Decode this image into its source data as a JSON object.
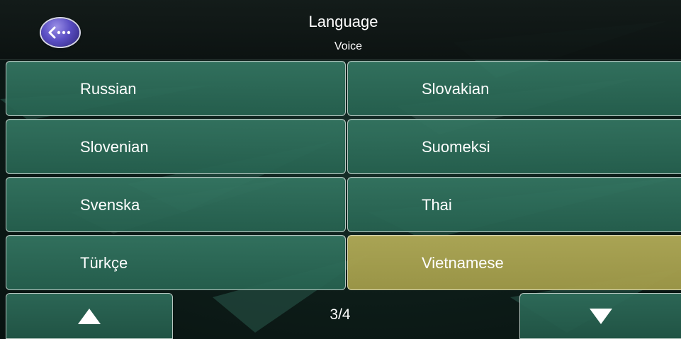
{
  "header": {
    "title": "Language",
    "subtitle": "Voice",
    "back_icon": "back-arrow-ellipsis-icon"
  },
  "languages": [
    {
      "label": "Russian",
      "selected": false
    },
    {
      "label": "Slovakian",
      "selected": false
    },
    {
      "label": "Slovenian",
      "selected": false
    },
    {
      "label": "Suomeksi",
      "selected": false
    },
    {
      "label": "Svenska",
      "selected": false
    },
    {
      "label": "Thai",
      "selected": false
    },
    {
      "label": "Türkçe",
      "selected": false
    },
    {
      "label": "Vietnamese",
      "selected": true
    }
  ],
  "pager": {
    "indicator": "3/4",
    "up_icon": "triangle-up-icon",
    "down_icon": "triangle-down-icon"
  },
  "colors": {
    "button_green": "#2f6e5a",
    "selected_olive": "#a8a252",
    "header_dark": "#141c1a",
    "back_button_purple": "#5b4fc4",
    "text": "#ffffff"
  }
}
